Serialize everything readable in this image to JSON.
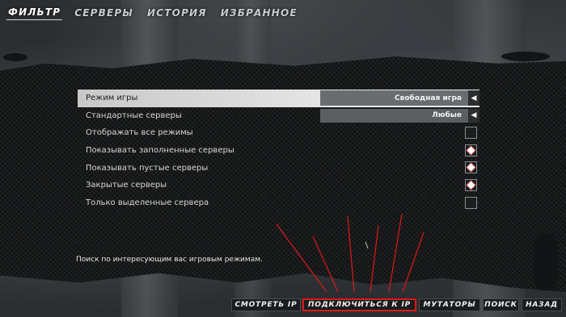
{
  "tabs": [
    {
      "label": "ФИЛЬТР",
      "active": true
    },
    {
      "label": "СЕРВЕРЫ",
      "active": false
    },
    {
      "label": "ИСТОРИЯ",
      "active": false
    },
    {
      "label": "ИЗБРАННОЕ",
      "active": false
    }
  ],
  "options": [
    {
      "label": "Режим игры",
      "kind": "select",
      "value": "Свободная игра",
      "selected": true,
      "arrow_icon": "arrow-left-icon"
    },
    {
      "label": "Стандартные серверы",
      "kind": "select",
      "value": "Любые",
      "selected": false,
      "arrow_icon": "arrow-left-icon"
    },
    {
      "label": "Отображать все режимы",
      "kind": "checkbox",
      "checked": false
    },
    {
      "label": "Показывать заполненные серверы",
      "kind": "checkbox",
      "checked": true
    },
    {
      "label": "Показывать пустые серверы",
      "kind": "checkbox",
      "checked": true
    },
    {
      "label": "Закрытые серверы",
      "kind": "checkbox",
      "checked": true
    },
    {
      "label": "Только выделенные сервера",
      "kind": "checkbox",
      "checked": false
    }
  ],
  "description": "Поиск по интересующим вас игровым режимам.",
  "buttons": {
    "view_ip": "СМОТРЕТЬ IP",
    "connect_ip": "ПОДКЛЮЧИТЬСЯ К IP",
    "mutators": "МУТАТОРЫ",
    "search": "ПОИСК",
    "back": "НАЗАД"
  },
  "colors": {
    "annotation_red": "#e01818",
    "selected_row": "#e0e0e0",
    "panel": "#16181a"
  }
}
